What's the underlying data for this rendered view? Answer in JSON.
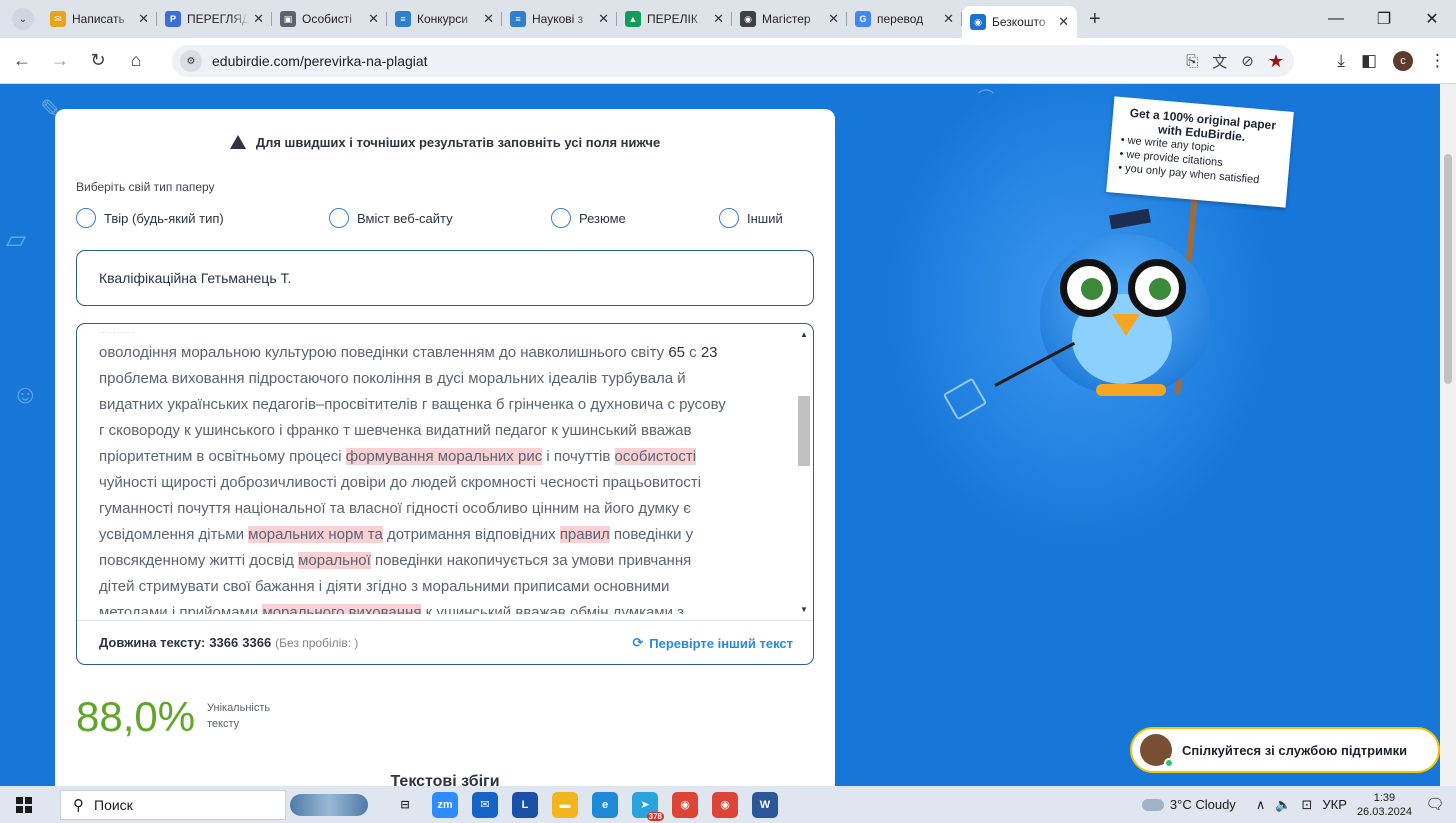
{
  "browser": {
    "tabs": [
      {
        "title": "Написать",
        "favicon_color": "#e8a317",
        "favicon_text": "✉"
      },
      {
        "title": "ПЕРЕГЛЯД",
        "favicon_color": "#3b6fd8",
        "favicon_text": "P"
      },
      {
        "title": "Особисті",
        "favicon_color": "#5a6470",
        "favicon_text": "▣"
      },
      {
        "title": "Конкурси",
        "favicon_color": "#2f7fd0",
        "favicon_text": "≡"
      },
      {
        "title": "Наукові з",
        "favicon_color": "#2f7fd0",
        "favicon_text": "≡"
      },
      {
        "title": "ПЕРЕЛІК",
        "favicon_color": "#0f9d58",
        "favicon_text": "▲"
      },
      {
        "title": "Магістер",
        "favicon_color": "#3c4043",
        "favicon_text": "◉"
      },
      {
        "title": "перевод",
        "favicon_color": "#4285f4",
        "favicon_text": "G"
      },
      {
        "title": "Безкошто",
        "favicon_color": "#1e6fd0",
        "favicon_text": "◉",
        "active": true
      }
    ],
    "url": "edubirdie.com/perevirka-na-plagiat",
    "profile_initial": "c"
  },
  "form": {
    "notice": "Для швидших і точніших результатів заповніть усі поля нижче",
    "paper_type_label": "Виберіть свій тип паперу",
    "paper_types": [
      "Твір (будь-який тип)",
      "Вміст веб-сайту",
      "Резюме",
      "Інший"
    ],
    "title_value": "Кваліфікаційна Гетьманець Т.",
    "text_lines": [
      [
        {
          "t": "оволодіння моральною культурою поведінки ставленням до навколишнього світу "
        },
        {
          "t": "65",
          "n": true
        },
        {
          "t": " с "
        },
        {
          "t": "23",
          "n": true
        }
      ],
      [
        {
          "t": "проблема виховання підростаючого покоління в дусі моральних ідеалів турбувала й"
        }
      ],
      [
        {
          "t": "видатних українських педагогів–просвітителів г ващенка б грінченка о духновича с русову"
        }
      ],
      [
        {
          "t": "г сковороду к ушинського і франко т шевченка видатний педагог к ушинський вважав"
        }
      ],
      [
        {
          "t": "пріоритетним в освітньому процесі "
        },
        {
          "t": "формування моральних рис",
          "h": true
        },
        {
          "t": " і почуттів "
        },
        {
          "t": "особистості",
          "h": true
        }
      ],
      [
        {
          "t": "чуйності щирості доброзичливості довіри до людей скромності чесності працьовитості"
        }
      ],
      [
        {
          "t": "гуманності почуття національної та власної гідності особливо цінним на його думку є"
        }
      ],
      [
        {
          "t": "усвідомлення дітьми "
        },
        {
          "t": "моральних норм та",
          "h": true
        },
        {
          "t": " дотримання відповідних "
        },
        {
          "t": "правил",
          "h": true
        },
        {
          "t": " поведінки у"
        }
      ],
      [
        {
          "t": "повсякденному житті досвід "
        },
        {
          "t": "моральної",
          "h": true
        },
        {
          "t": " поведінки накопичується за умови привчання"
        }
      ],
      [
        {
          "t": "дітей стримувати свої бажання і діяти згідно з моральними приписами основними"
        }
      ],
      [
        {
          "t": "методами і прийомами "
        },
        {
          "t": "морального виховання",
          "h": true
        },
        {
          "t": " к ушинський вважав обмін думками з"
        }
      ]
    ],
    "length_label": "Довжина тексту:",
    "length_value": "3366",
    "length_value_repeat": "3366",
    "no_spaces_label": "(Без пробілів: )",
    "recheck_label": "Перевірте інший текст"
  },
  "result": {
    "uniqueness_percent": "88,0%",
    "uniqueness_label": "Унікальність тексту",
    "matches_title": "Текстові збіги"
  },
  "promo": {
    "sign_title": "Get a 100% original paper with EduBirdie.",
    "sign_items": [
      "• we write any topic",
      "• we provide citations",
      "• you only pay when satisfied"
    ]
  },
  "chat": {
    "label": "Спілкуйтеся зі службою підтримки"
  },
  "taskbar": {
    "search_placeholder": "Поиск",
    "weather": "3°C Cloudy",
    "language": "УКР",
    "time": "1:39",
    "date": "26.03.2024",
    "telegram_badge": "378",
    "notif_count": "1",
    "apps": [
      {
        "name": "task-view",
        "color": "#dfe6ef",
        "text": "⊟",
        "textColor": "#222"
      },
      {
        "name": "zoom",
        "color": "#2d8cff",
        "text": "zm"
      },
      {
        "name": "mail",
        "color": "#1464c8",
        "text": "✉"
      },
      {
        "name": "l-app",
        "color": "#1b4fa8",
        "text": "L"
      },
      {
        "name": "file-explorer",
        "color": "#f2b51e",
        "text": "▬"
      },
      {
        "name": "edge",
        "color": "#1d8ad8",
        "text": "e"
      },
      {
        "name": "telegram",
        "color": "#2aa3df",
        "text": "➤"
      },
      {
        "name": "chrome-profile-1",
        "color": "#db4437",
        "text": "◉"
      },
      {
        "name": "chrome-profile-2",
        "color": "#db4437",
        "text": "◉"
      },
      {
        "name": "word",
        "color": "#2b579a",
        "text": "W"
      }
    ]
  }
}
